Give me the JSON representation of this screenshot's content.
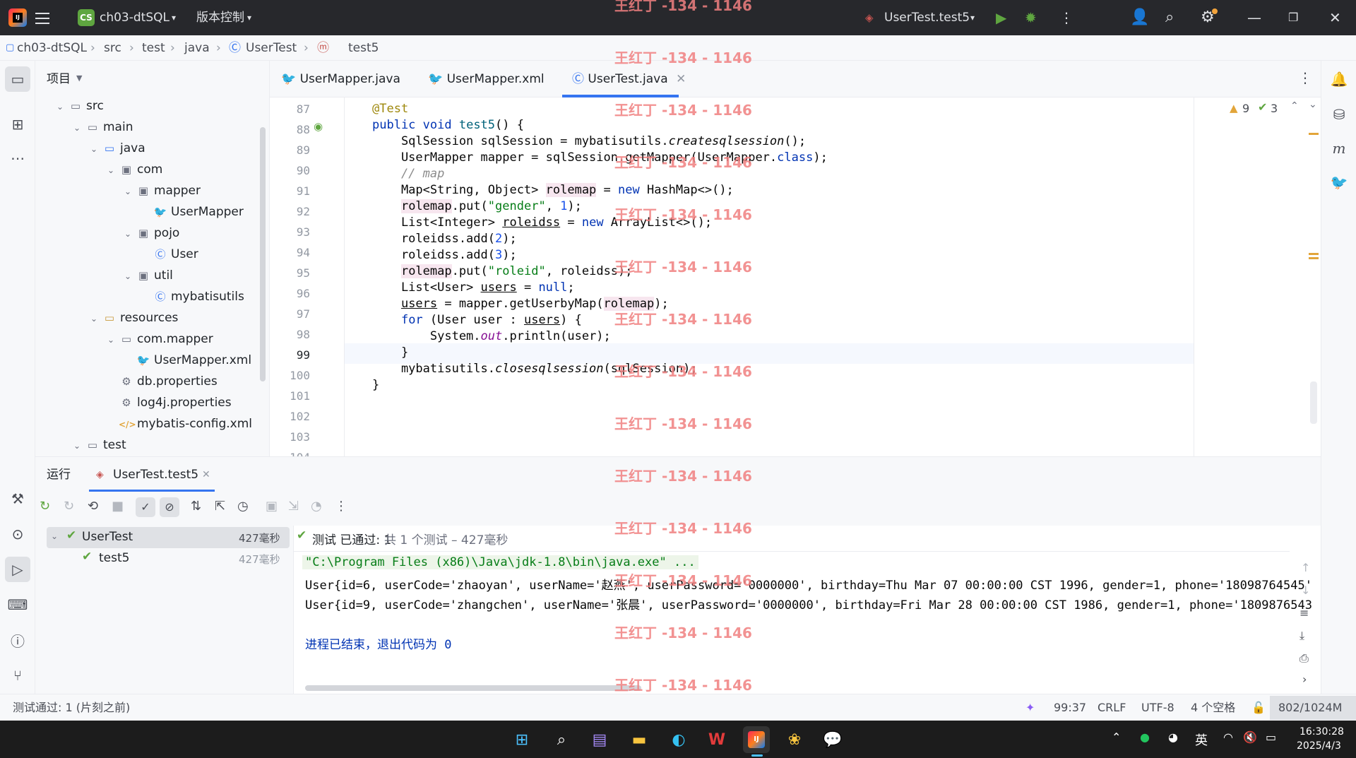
{
  "titlebar": {
    "project_badge": "CS",
    "project_name": "ch03-dtSQL",
    "vcs_label": "版本控制",
    "run_config": "UserTest.test5"
  },
  "breadcrumb": [
    "ch03-dtSQL",
    "src",
    "test",
    "java",
    "UserTest",
    "test5"
  ],
  "project_panel": {
    "title": "项目",
    "tree": [
      {
        "label": "src",
        "depth": 0,
        "type": "folder",
        "expanded": true
      },
      {
        "label": "main",
        "depth": 1,
        "type": "folder",
        "expanded": true
      },
      {
        "label": "java",
        "depth": 2,
        "type": "src-folder",
        "expanded": true
      },
      {
        "label": "com",
        "depth": 3,
        "type": "package",
        "expanded": true
      },
      {
        "label": "mapper",
        "depth": 4,
        "type": "package",
        "expanded": true
      },
      {
        "label": "UserMapper",
        "depth": 5,
        "type": "mybatis"
      },
      {
        "label": "pojo",
        "depth": 4,
        "type": "package",
        "expanded": true
      },
      {
        "label": "User",
        "depth": 5,
        "type": "class"
      },
      {
        "label": "util",
        "depth": 4,
        "type": "package",
        "expanded": true
      },
      {
        "label": "mybatisutils",
        "depth": 5,
        "type": "class"
      },
      {
        "label": "resources",
        "depth": 2,
        "type": "res-folder",
        "expanded": true
      },
      {
        "label": "com.mapper",
        "depth": 3,
        "type": "folder",
        "expanded": true
      },
      {
        "label": "UserMapper.xml",
        "depth": 4,
        "type": "mybatis"
      },
      {
        "label": "db.properties",
        "depth": 3,
        "type": "props"
      },
      {
        "label": "log4j.properties",
        "depth": 3,
        "type": "props"
      },
      {
        "label": "mybatis-config.xml",
        "depth": 3,
        "type": "xml"
      },
      {
        "label": "test",
        "depth": 1,
        "type": "folder",
        "expanded": true
      }
    ]
  },
  "editor": {
    "tabs": [
      {
        "label": "UserMapper.java",
        "active": false
      },
      {
        "label": "UserMapper.xml",
        "active": false
      },
      {
        "label": "UserTest.java",
        "active": true
      }
    ],
    "inspections": {
      "warnings": "9",
      "weak_warnings": "3"
    },
    "line_numbers": [
      "87",
      "88",
      "89",
      "90",
      "91",
      "92",
      "93",
      "94",
      "95",
      "96",
      "97",
      "98",
      "99",
      "100",
      "101",
      "102",
      "103",
      "104"
    ]
  },
  "run_panel": {
    "title": "运行",
    "tab": "UserTest.test5",
    "tree": [
      {
        "label": "UserTest",
        "time": "427毫秒"
      },
      {
        "label": "test5",
        "time": "427毫秒"
      }
    ],
    "summary_prefix": "测试 已通过: 1",
    "summary_suffix": "共 1 个测试 – 427毫秒",
    "console": [
      "\"C:\\Program Files (x86)\\Java\\jdk-1.8\\bin\\java.exe\" ...",
      "User{id=6, userCode='zhaoyan', userName='赵燕', userPassword='0000000', birthday=Thu Mar 07 00:00:00 CST 1996, gender=1, phone='18098764545'",
      "User{id=9, userCode='zhangchen', userName='张晨', userPassword='0000000', birthday=Fri Mar 28 00:00:00 CST 1986, gender=1, phone='1809876543",
      "",
      "进程已结束，退出代码为 0"
    ]
  },
  "statusbar": {
    "left": "测试通过: 1 (片刻之前)",
    "position": "99:37",
    "line_sep": "CRLF",
    "encoding": "UTF-8",
    "indent": "4 个空格",
    "memory": "802/1024M"
  },
  "taskbar": {
    "lang": "英",
    "time": "16:30:28",
    "date": "2025/4/3"
  },
  "watermark": "王红丁 -134 - 1146",
  "colors": {
    "accent": "#3574f0",
    "title_bg": "#27282c",
    "taskbar_bg": "#1c1c1c",
    "pass_green": "#5fa640",
    "watermark": "#f08080"
  }
}
